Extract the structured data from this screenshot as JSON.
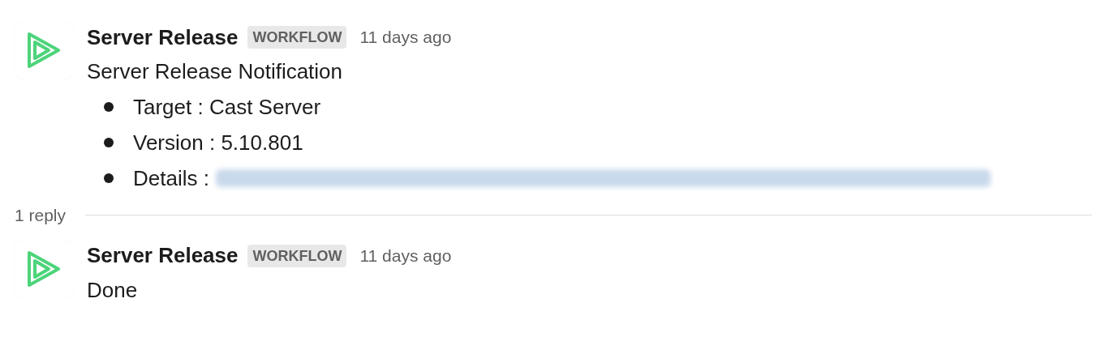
{
  "messages": [
    {
      "sender": "Server Release",
      "badge": "WORKFLOW",
      "time": "11 days ago",
      "text": "Server Release Notification",
      "items": [
        {
          "kind": "text",
          "label": "Target : Cast Server"
        },
        {
          "kind": "text",
          "label": "Version : 5.10.801"
        },
        {
          "kind": "redacted-link",
          "label": "Details :"
        }
      ]
    }
  ],
  "thread": {
    "reply_count": "1 reply"
  },
  "replies": [
    {
      "sender": "Server Release",
      "badge": "WORKFLOW",
      "time": "11 days ago",
      "text": "Done"
    }
  ]
}
